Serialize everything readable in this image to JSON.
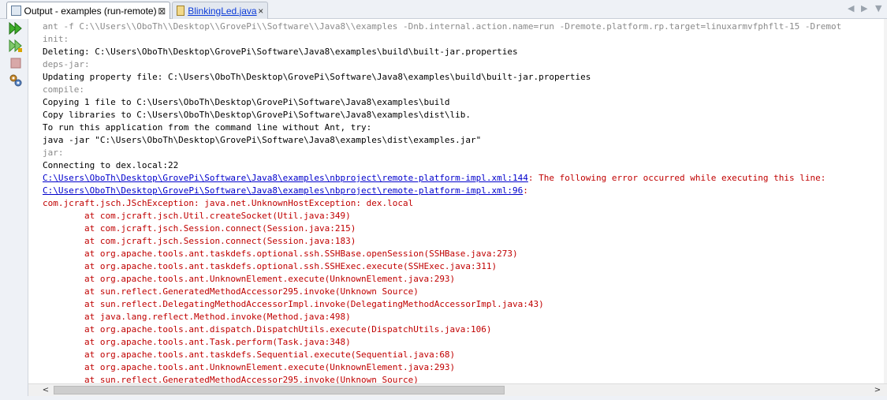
{
  "tabs": [
    {
      "label": "Output - examples (run-remote)",
      "close": "⊠",
      "icon": "output-window-icon"
    },
    {
      "label": "BlinkingLed.java",
      "close": "×",
      "icon": "java-file-icon"
    }
  ],
  "nav": {
    "left": "◀",
    "right": "▶",
    "menu": "▼"
  },
  "toolbar": [
    "rerun-icon",
    "rerun-with-options-icon",
    "stop-icon",
    "settings-icon"
  ],
  "console": {
    "lines": [
      {
        "text": "ant -f C:\\\\Users\\\\OboTh\\\\Desktop\\\\GrovePi\\\\Software\\\\Java8\\\\examples -Dnb.internal.action.name=run -Dremote.platform.rp.target=linuxarmvfphflt-15 -Dremot",
        "style": "gray"
      },
      {
        "text": "init:",
        "style": "gray"
      },
      {
        "text": "Deleting: C:\\Users\\OboTh\\Desktop\\GrovePi\\Software\\Java8\\examples\\build\\built-jar.properties",
        "style": "black"
      },
      {
        "text": "deps-jar:",
        "style": "gray"
      },
      {
        "text": "Updating property file: C:\\Users\\OboTh\\Desktop\\GrovePi\\Software\\Java8\\examples\\build\\built-jar.properties",
        "style": "black"
      },
      {
        "text": "compile:",
        "style": "gray"
      },
      {
        "text": "Copying 1 file to C:\\Users\\OboTh\\Desktop\\GrovePi\\Software\\Java8\\examples\\build",
        "style": "black"
      },
      {
        "text": "Copy libraries to C:\\Users\\OboTh\\Desktop\\GrovePi\\Software\\Java8\\examples\\dist\\lib.",
        "style": "black"
      },
      {
        "text": "To run this application from the command line without Ant, try:",
        "style": "black"
      },
      {
        "text": "java -jar \"C:\\Users\\OboTh\\Desktop\\GrovePi\\Software\\Java8\\examples\\dist\\examples.jar\"",
        "style": "black"
      },
      {
        "text": "jar:",
        "style": "gray"
      },
      {
        "text": "Connecting to dex.local:22",
        "style": "black"
      },
      {
        "link": "C:\\Users\\OboTh\\Desktop\\GrovePi\\Software\\Java8\\examples\\nbproject\\remote-platform-impl.xml:144",
        "rest": ": The following error occurred while executing this line:"
      },
      {
        "link": "C:\\Users\\OboTh\\Desktop\\GrovePi\\Software\\Java8\\examples\\nbproject\\remote-platform-impl.xml:96",
        "rest": ":"
      },
      {
        "text": "com.jcraft.jsch.JSchException: java.net.UnknownHostException: dex.local",
        "style": "red"
      },
      {
        "text": "        at com.jcraft.jsch.Util.createSocket(Util.java:349)",
        "style": "red"
      },
      {
        "text": "        at com.jcraft.jsch.Session.connect(Session.java:215)",
        "style": "red"
      },
      {
        "text": "        at com.jcraft.jsch.Session.connect(Session.java:183)",
        "style": "red"
      },
      {
        "text": "        at org.apache.tools.ant.taskdefs.optional.ssh.SSHBase.openSession(SSHBase.java:273)",
        "style": "red"
      },
      {
        "text": "        at org.apache.tools.ant.taskdefs.optional.ssh.SSHExec.execute(SSHExec.java:311)",
        "style": "red"
      },
      {
        "text": "        at org.apache.tools.ant.UnknownElement.execute(UnknownElement.java:293)",
        "style": "red"
      },
      {
        "text": "        at sun.reflect.GeneratedMethodAccessor295.invoke(Unknown Source)",
        "style": "red"
      },
      {
        "text": "        at sun.reflect.DelegatingMethodAccessorImpl.invoke(DelegatingMethodAccessorImpl.java:43)",
        "style": "red"
      },
      {
        "text": "        at java.lang.reflect.Method.invoke(Method.java:498)",
        "style": "red"
      },
      {
        "text": "        at org.apache.tools.ant.dispatch.DispatchUtils.execute(DispatchUtils.java:106)",
        "style": "red"
      },
      {
        "text": "        at org.apache.tools.ant.Task.perform(Task.java:348)",
        "style": "red"
      },
      {
        "text": "        at org.apache.tools.ant.taskdefs.Sequential.execute(Sequential.java:68)",
        "style": "red"
      },
      {
        "text": "        at org.apache.tools.ant.UnknownElement.execute(UnknownElement.java:293)",
        "style": "red"
      },
      {
        "text": "        at sun.reflect.GeneratedMethodAccessor295.invoke(Unknown Source)",
        "style": "red"
      }
    ]
  },
  "scrollbar": {
    "left_arrow": "<",
    "right_arrow": ">"
  }
}
